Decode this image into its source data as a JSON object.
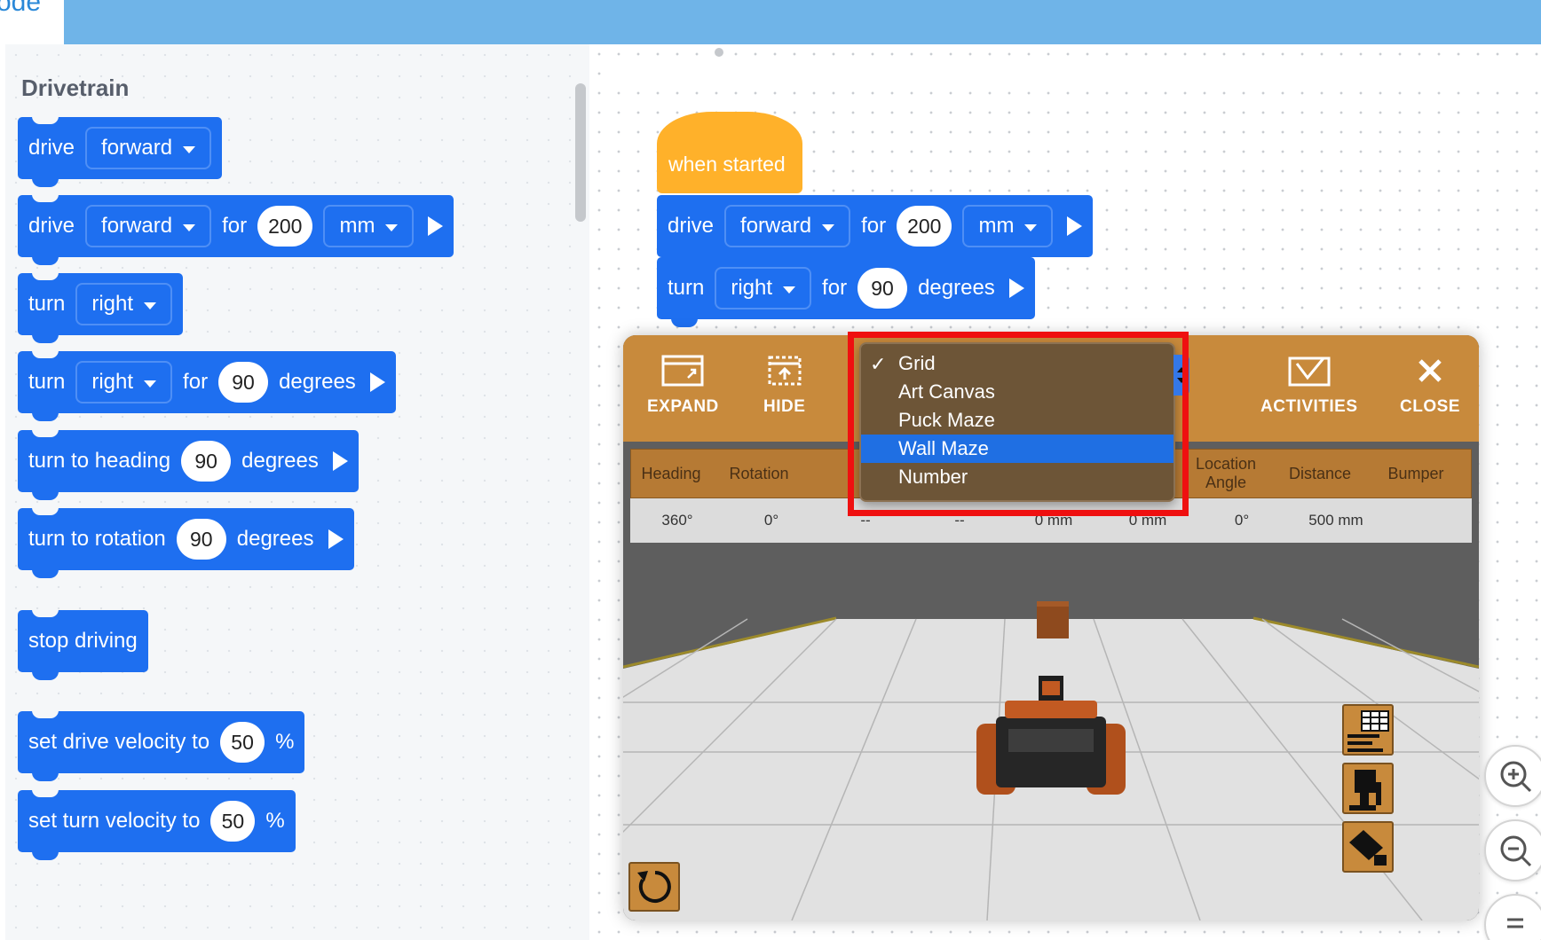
{
  "header": {
    "tab_text": "ode"
  },
  "palette": {
    "title": "Drivetrain",
    "blocks": {
      "drive": {
        "label": "drive",
        "dir": "forward"
      },
      "drive_for": {
        "label": "drive",
        "dir": "forward",
        "for": "for",
        "amount": "200",
        "unit": "mm"
      },
      "turn": {
        "label": "turn",
        "dir": "right"
      },
      "turn_for": {
        "label": "turn",
        "dir": "right",
        "for": "for",
        "amount": "90",
        "unit": "degrees"
      },
      "turn_heading": {
        "label": "turn to heading",
        "amount": "90",
        "unit": "degrees"
      },
      "turn_rotation": {
        "label": "turn to rotation",
        "amount": "90",
        "unit": "degrees"
      },
      "stop": {
        "label": "stop driving"
      },
      "drive_velocity": {
        "label": "set drive velocity to",
        "amount": "50",
        "unit": "%"
      },
      "turn_velocity": {
        "label": "set turn velocity to",
        "amount": "50",
        "unit": "%"
      }
    }
  },
  "workspace": {
    "hat": "when started",
    "drive_for": {
      "label": "drive",
      "dir": "forward",
      "for": "for",
      "amount": "200",
      "unit": "mm"
    },
    "turn_for": {
      "label": "turn",
      "dir": "right",
      "for": "for",
      "amount": "90",
      "unit": "degrees"
    }
  },
  "simulator": {
    "toolbar": {
      "expand": "EXPAND",
      "hide": "HIDE",
      "activities": "ACTIVITIES",
      "close": "CLOSE"
    },
    "table": {
      "headers": [
        "Heading",
        "Rotation",
        "Location Angle",
        "Distance",
        "Bumper"
      ],
      "values": [
        "360°",
        "0°",
        "--",
        "--",
        "0 mm",
        "0 mm",
        "0°",
        "500 mm"
      ],
      "extra": "--"
    },
    "dropdown": {
      "options": [
        "Grid",
        "Art Canvas",
        "Puck Maze",
        "Wall Maze",
        "Number"
      ],
      "checked": "Grid",
      "highlighted": "Wall Maze",
      "check_mark": "✓"
    }
  },
  "colors": {
    "block": "#1e6ff0",
    "hat": "#ffb12a",
    "sim_toolbar": "#c88a3c",
    "highlight_box": "#ef1010",
    "selection": "#1f6fe3"
  }
}
